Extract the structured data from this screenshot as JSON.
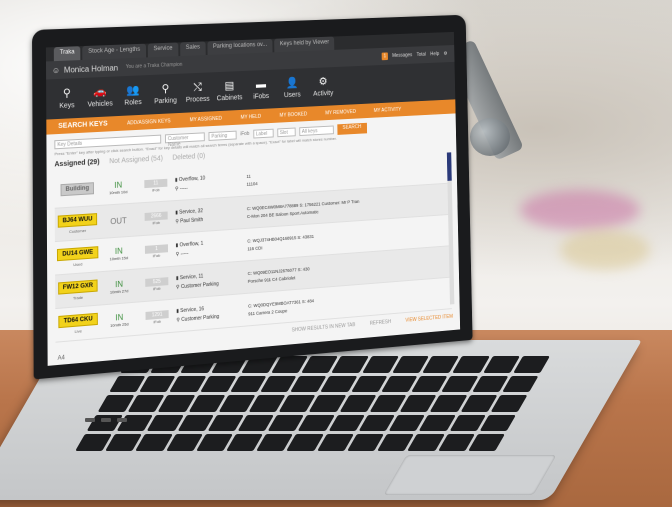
{
  "tabs": [
    "Traka",
    "Stock Age - Lengths",
    "Service",
    "Sales",
    "Parking locations ov...",
    "Keys held by Viewer"
  ],
  "user": {
    "name": "Monica Holman",
    "subtitle": "You are a Traka Champion",
    "messages": "Messages",
    "total": "Total",
    "help": "Help"
  },
  "toolbar": [
    {
      "label": "Keys",
      "icon": "key-icon",
      "glyph": "⚲"
    },
    {
      "label": "Vehicles",
      "icon": "car-icon",
      "glyph": "🚗"
    },
    {
      "label": "Roles",
      "icon": "people-icon",
      "glyph": "👥"
    },
    {
      "label": "Parking",
      "icon": "pin-icon",
      "glyph": "⚲"
    },
    {
      "label": "Process",
      "icon": "shuffle-icon",
      "glyph": "⤭"
    },
    {
      "label": "Cabinets",
      "icon": "cabinet-icon",
      "glyph": "▤"
    },
    {
      "label": "iFobs",
      "icon": "fob-icon",
      "glyph": "▬"
    },
    {
      "label": "Users",
      "icon": "user-icon",
      "glyph": "👤"
    },
    {
      "label": "Activity",
      "icon": "activity-icon",
      "glyph": "⚙"
    }
  ],
  "orange_bar": [
    "SEARCH KEYS",
    "ADD/ASSIGN KEYS",
    "MY ASSIGNED",
    "MY HELD",
    "MY BOOKED",
    "MY REMOVED",
    "MY ACTIVITY"
  ],
  "search": {
    "details": "Key Details",
    "customer": "Customer Name",
    "parking": "Parking",
    "fob": "iFob",
    "label": "Label",
    "slot": "Slot",
    "select": "All keys",
    "button": "SEARCH",
    "hint": "Press \"Enter\" key after typing or click search button. \"Exact\" for key details will match all search terms (separate with a space). \"Exact\" for label will match stores number."
  },
  "filters": {
    "assigned": "Assigned (29)",
    "not_assigned": "Not Assigned (54)",
    "deleted": "Deleted (0)"
  },
  "rows": [
    {
      "plate": "Building",
      "sub": "",
      "grey": true,
      "status": "IN",
      "date": "10mth 10d",
      "fob": "11",
      "loc1": "Overflow, 10",
      "loc2": "-----",
      "veh1": "11",
      "veh2": "11104"
    },
    {
      "plate": "BJ64 WUU",
      "sub": "Customer",
      "grey": false,
      "status": "OUT",
      "date": "",
      "fob": "2666",
      "loc1": "Service, 32",
      "loc2": "Paul Smith",
      "veh1": "C: WQ0EC4W0M8A778889  S: 1756221  Customer: Mr P Tran",
      "veh2": "C-Mon 204 BE Saloon Sport Automatic"
    },
    {
      "plate": "DU14 GWE",
      "sub": "Used",
      "grey": false,
      "status": "IN",
      "date": "10mth 15d",
      "fob": "1",
      "loc1": "Overflow, 1",
      "loc2": "-----",
      "veh1": "C: WQJ374HB04Q168915  S: 43831",
      "veh2": "116 CDI"
    },
    {
      "plate": "FW12 GXR",
      "sub": "Trade",
      "grey": false,
      "status": "IN",
      "date": "10mth 27d",
      "fob": "525",
      "loc1": "Service, 11",
      "loc2": "Customer Parking",
      "veh1": "C: WQ09EO11NJ2676077  S: 430",
      "veh2": "Porsche 911 C4 Cabriolet"
    },
    {
      "plate": "TD64 CKU",
      "sub": "Live",
      "grey": false,
      "status": "IN",
      "date": "10mth 25d",
      "fob": "1291",
      "loc1": "Service, 16",
      "loc2": "Customer Parking",
      "veh1": "C: WQ0DQYE9MBOAT7361  S: 484",
      "veh2": "911 Carrera 2 Coupe"
    }
  ],
  "footer": {
    "show": "SHOW RESULTS IN NEW TAB",
    "refresh": "REFRESH",
    "view": "VIEW SELECTED ITEM"
  },
  "bottom": "A4"
}
